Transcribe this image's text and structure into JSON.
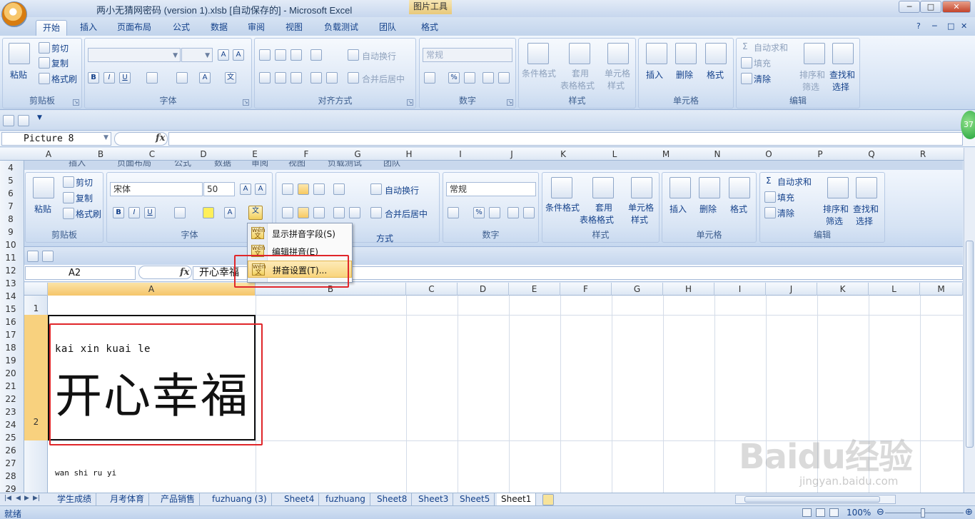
{
  "window": {
    "title": "两小无猜网密码 (version 1).xlsb [自动保存的] - Microsoft Excel",
    "context_tab": "图片工具",
    "min": "─",
    "max": "□",
    "close": "✕"
  },
  "tabs": [
    "开始",
    "插入",
    "页面布局",
    "公式",
    "数据",
    "审阅",
    "视图",
    "负载测试",
    "团队",
    "格式"
  ],
  "active_tab": "开始",
  "ribbon": {
    "clipboard": {
      "paste": "粘贴",
      "cut": "剪切",
      "copy": "复制",
      "format_painter": "格式刷",
      "label": "剪贴板"
    },
    "font": {
      "label": "字体",
      "bold": "B",
      "italic": "I",
      "underline": "U"
    },
    "align": {
      "wrap": "自动换行",
      "merge": "合并后居中",
      "label": "对齐方式"
    },
    "number": {
      "format": "常规",
      "percent": "%",
      "label": "数字"
    },
    "styles": {
      "cond": "条件格式",
      "table1": "套用",
      "table2": "表格格式",
      "cell1": "单元格",
      "cell2": "样式",
      "label": "样式"
    },
    "cells": {
      "insert": "插入",
      "delete": "删除",
      "format": "格式",
      "label": "单元格"
    },
    "editing": {
      "autosum": "自动求和",
      "fill": "填充",
      "clear": "清除",
      "sort1": "排序和",
      "sort2": "筛选",
      "find1": "查找和",
      "find2": "选择",
      "label": "编辑"
    }
  },
  "formula_bar": {
    "name_box": "Picture 8",
    "fx": "fx",
    "value": ""
  },
  "outer_columns": [
    "A",
    "B",
    "C",
    "D",
    "E",
    "F",
    "G",
    "H",
    "I",
    "J",
    "K",
    "L",
    "M",
    "N",
    "O",
    "P",
    "Q",
    "R"
  ],
  "outer_rows": [
    "4",
    "5",
    "6",
    "7",
    "8",
    "9",
    "10",
    "11",
    "12",
    "13",
    "14",
    "15",
    "16",
    "17",
    "18",
    "19",
    "20",
    "21",
    "22",
    "23",
    "24",
    "25",
    "26",
    "27",
    "28",
    "29"
  ],
  "green_badge": "37",
  "inner": {
    "tabs": [
      "插入",
      "页面布局",
      "公式",
      "数据",
      "审阅",
      "视图",
      "负载测试",
      "团队"
    ],
    "font_name": "宋体",
    "font_size": "50",
    "wrap": "自动换行",
    "merge": "合并后居中",
    "number_format": "常规",
    "clipboard": {
      "cut": "剪切",
      "copy": "复制",
      "painter": "格式刷",
      "paste": "粘贴",
      "label": "剪贴板"
    },
    "font_label": "字体",
    "align_label": "方式",
    "number_label": "数字",
    "styles": {
      "cond": "条件格式",
      "table1": "套用",
      "table2": "表格格式",
      "cell1": "单元格",
      "cell2": "样式",
      "label": "样式"
    },
    "cells": {
      "insert": "插入",
      "delete": "删除",
      "format": "格式",
      "label": "单元格"
    },
    "editing": {
      "autosum": "自动求和",
      "fill": "填充",
      "clear": "清除",
      "sort1": "排序和",
      "sort2": "筛选",
      "find1": "查找和",
      "find2": "选择",
      "label": "编辑"
    },
    "name_box": "A2",
    "formula_value": "开心幸福",
    "columns": [
      "A",
      "B",
      "C",
      "D",
      "E",
      "F",
      "G",
      "H",
      "I",
      "J",
      "K",
      "L",
      "M"
    ],
    "rows": [
      "1",
      "2"
    ],
    "pinyin1": "kai  xin  kuai  le",
    "cell_text": "开心幸福",
    "pinyin2": "wan shi ru yi"
  },
  "context_menu": [
    {
      "label": "显示拼音字段(S)"
    },
    {
      "label": "编辑拼音(E)"
    },
    {
      "label": "拼音设置(T)..."
    }
  ],
  "sheets": [
    "学生成绩",
    "月考体育",
    "产品销售",
    "fuzhuang (3)",
    "Sheet4",
    "fuzhuang",
    "Sheet8",
    "Sheet3",
    "Sheet5",
    "Sheet1"
  ],
  "active_sheet": "Sheet1",
  "status": {
    "ready": "就绪",
    "zoom": "100%"
  },
  "watermark": {
    "logo": "Baidu经验",
    "url": "jingyan.baidu.com"
  }
}
